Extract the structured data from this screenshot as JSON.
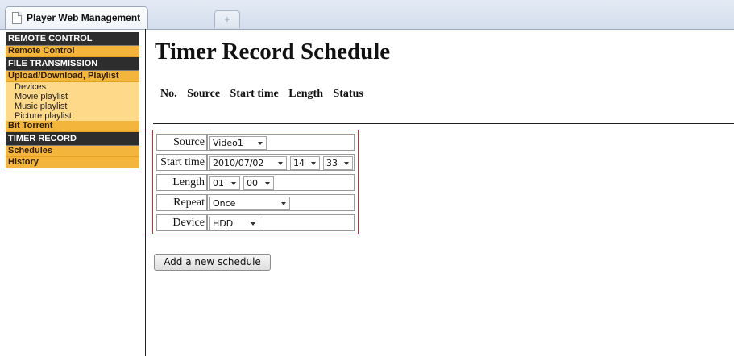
{
  "browser": {
    "tab_title": "Player Web Management",
    "new_tab_glyph": "+"
  },
  "sidebar": {
    "remote_control_header": "REMOTE CONTROL",
    "remote_control_link": "Remote Control",
    "file_transmission_header": "FILE TRANSMISSION",
    "upload_download_link": "Upload/Download, Playlist",
    "sub_items": [
      "Devices",
      "Movie playlist",
      "Music playlist",
      "Picture playlist"
    ],
    "bit_torrent_link": "Bit Torrent",
    "timer_record_header": "TIMER RECORD",
    "schedules_link": "Schedules",
    "history_link": "History"
  },
  "main": {
    "title": "Timer Record Schedule",
    "columns": [
      "No.",
      "Source",
      "Start time",
      "Length",
      "Status"
    ]
  },
  "form": {
    "source": {
      "label": "Source",
      "value": "Video1"
    },
    "start_time": {
      "label": "Start time",
      "date": "2010/07/02",
      "hour": "14",
      "minute": "33"
    },
    "length": {
      "label": "Length",
      "hours": "01",
      "minutes": "00"
    },
    "repeat": {
      "label": "Repeat",
      "value": "Once"
    },
    "device": {
      "label": "Device",
      "value": "HDD"
    }
  },
  "add_button_label": "Add a new schedule",
  "colors": {
    "sidebar_header_bg": "#2d2d2d",
    "sidebar_link_bg": "#f4b53c",
    "sidebar_sub_bg": "#ffd98a",
    "form_border": "#d7282c"
  }
}
